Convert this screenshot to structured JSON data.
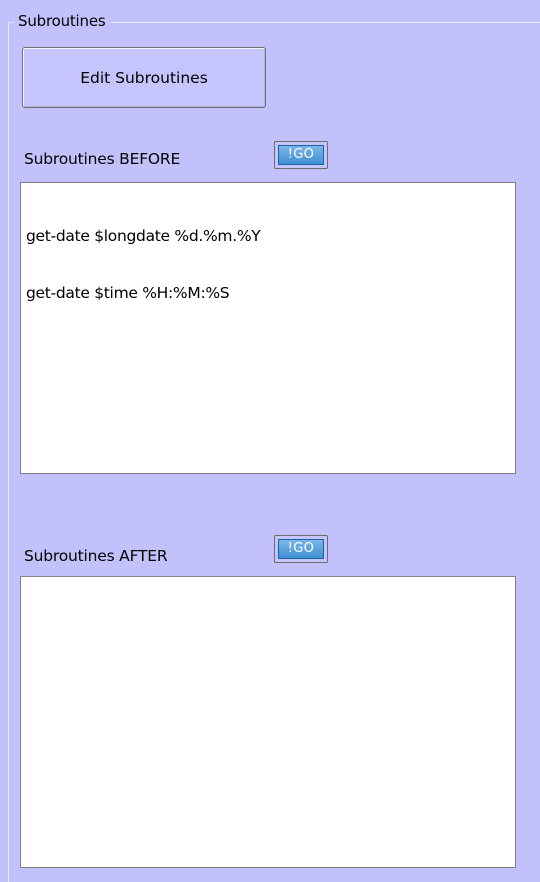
{
  "groupbox": {
    "title": "Subroutines"
  },
  "edit_button": {
    "label": "Edit Subroutines"
  },
  "before": {
    "label": "Subroutines BEFORE",
    "go_label": "!GO",
    "lines": [
      "get-date $longdate %d.%m.%Y",
      "get-date $time %H:%M:%S"
    ]
  },
  "after": {
    "label": "Subroutines AFTER",
    "go_label": "!GO",
    "lines": []
  },
  "colors": {
    "background": "#c3c1fb",
    "go_button": "#4a97d8"
  }
}
